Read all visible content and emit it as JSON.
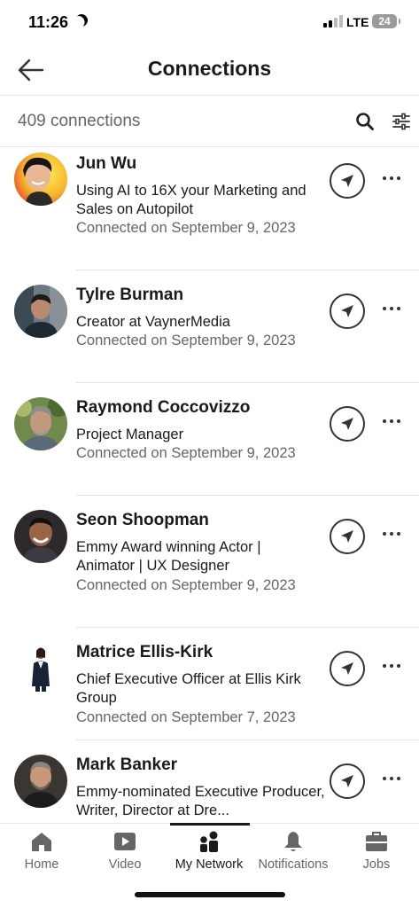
{
  "status_bar": {
    "time": "11:26",
    "network": "LTE",
    "battery": "24"
  },
  "header": {
    "title": "Connections"
  },
  "subheader": {
    "count_label": "409 connections"
  },
  "connections": [
    {
      "name": "Jun Wu",
      "headline": "Using AI to 16X your Marketing and Sales on Autopilot",
      "connected": "Connected on September 9, 2023"
    },
    {
      "name": "Tylre Burman",
      "headline": "Creator at VaynerMedia",
      "connected": "Connected on September 9, 2023"
    },
    {
      "name": "Raymond Coccovizzo",
      "headline": "Project Manager",
      "connected": "Connected on September 9, 2023"
    },
    {
      "name": "Seon Shoopman",
      "headline": "Emmy Award winning Actor | Animator | UX Designer",
      "connected": "Connected on September 9, 2023"
    },
    {
      "name": "Matrice Ellis-Kirk",
      "headline": "Chief Executive Officer at Ellis Kirk Group",
      "connected": "Connected on September 7, 2023"
    },
    {
      "name": "Mark Banker",
      "headline": "Emmy-nominated Executive Producer, Writer, Director at Dre...",
      "connected": ""
    }
  ],
  "bottom_nav": {
    "items": [
      {
        "label": "Home",
        "icon": "home-icon"
      },
      {
        "label": "Video",
        "icon": "video-icon"
      },
      {
        "label": "My Network",
        "icon": "my-network-icon"
      },
      {
        "label": "Notifications",
        "icon": "bell-icon"
      },
      {
        "label": "Jobs",
        "icon": "briefcase-icon"
      }
    ],
    "active": "My Network"
  },
  "colors": {
    "text_primary": "#1a1a1a",
    "text_secondary": "#666666",
    "divider": "#e4e4e4",
    "icon": "#333333"
  }
}
